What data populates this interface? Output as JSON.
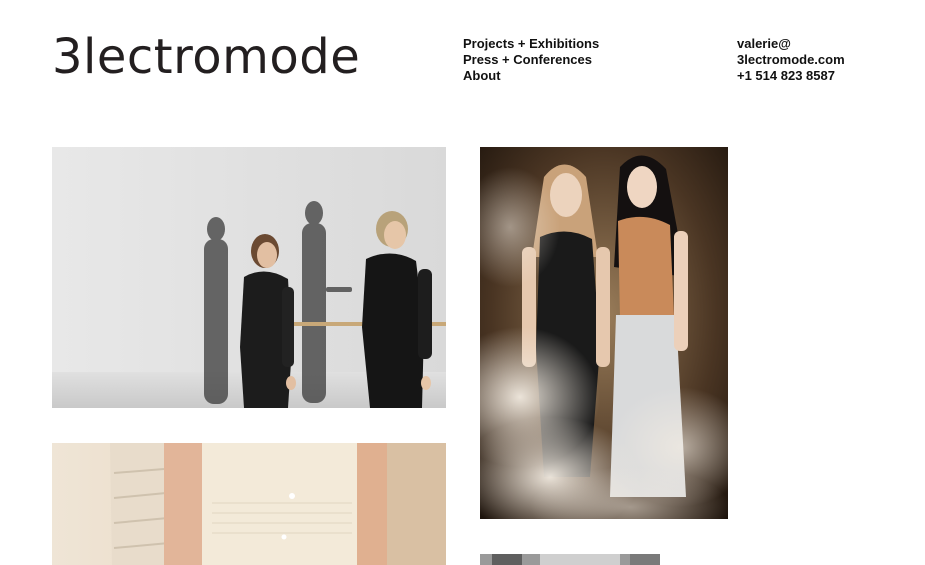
{
  "site": {
    "logo_text": "3lectromode"
  },
  "nav": {
    "items": [
      {
        "label": "Projects + Exhibitions"
      },
      {
        "label": "Press + Conferences"
      },
      {
        "label": "About"
      }
    ]
  },
  "contact": {
    "email_line1": "valerie@",
    "email_line2": "3lectromode.com",
    "phone": "+1 514 823 8587"
  },
  "gallery": {
    "items": [
      {
        "subject": "two-models-black-garments-with-shadows"
      },
      {
        "subject": "two-models-in-smoke"
      },
      {
        "subject": "cream-garment-closeup"
      },
      {
        "subject": "partial-photo-cropped"
      }
    ]
  }
}
